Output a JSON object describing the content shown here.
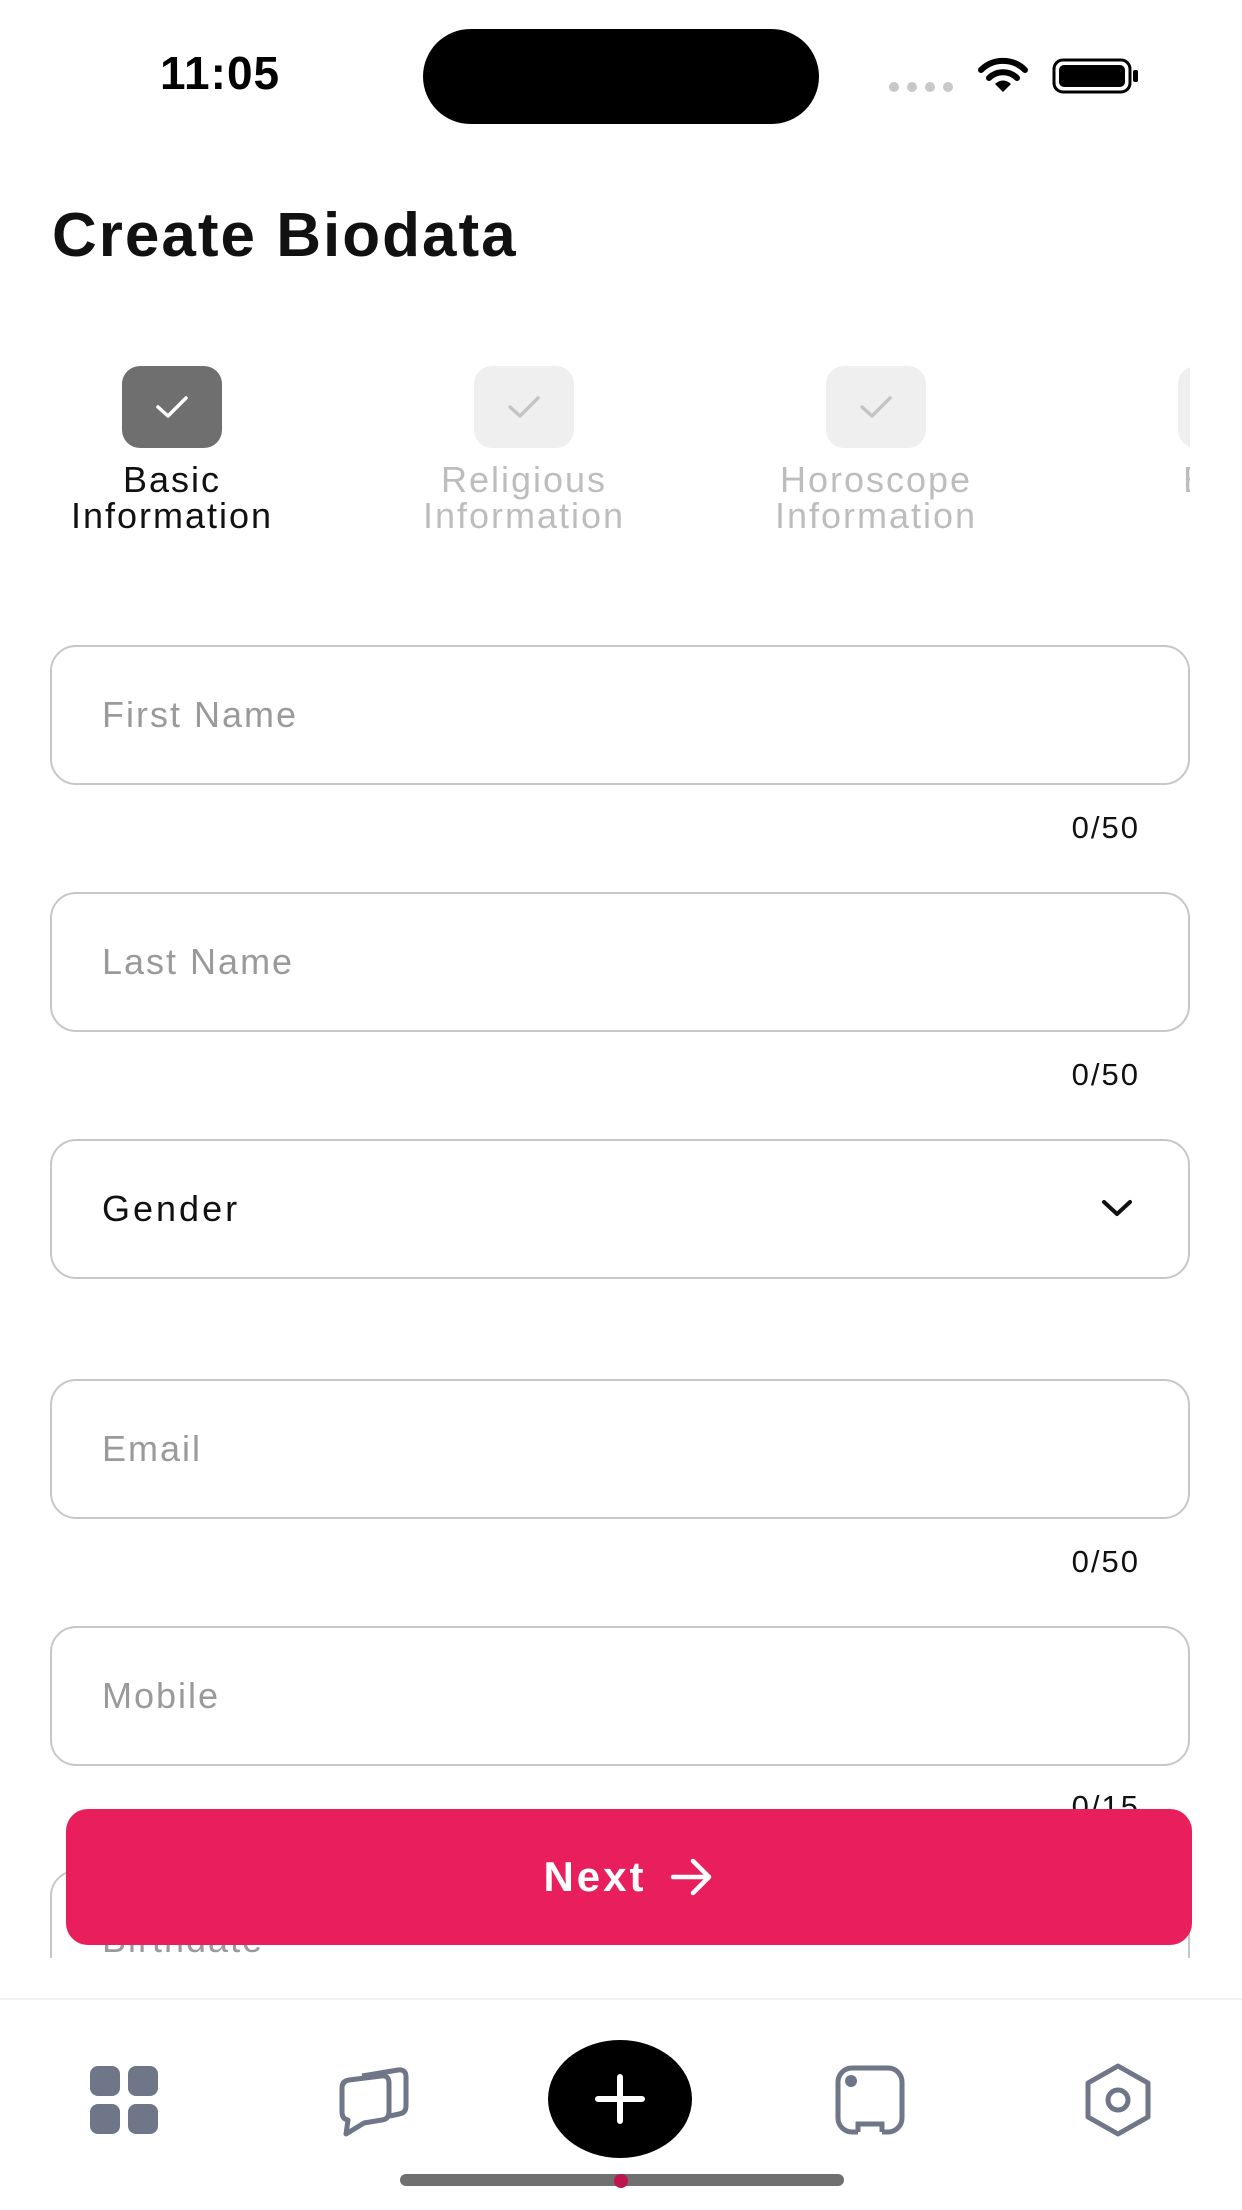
{
  "status_bar": {
    "time": "11:05"
  },
  "header": {
    "title": "Create Biodata"
  },
  "stepper": {
    "steps": [
      {
        "label": "Basic\nInformation",
        "state": "active"
      },
      {
        "label": "Religious\nInformation",
        "state": "inactive"
      },
      {
        "label": "Horoscope\nInformation",
        "state": "inactive"
      },
      {
        "label": "Educ\nLo",
        "state": "inactive"
      }
    ]
  },
  "form": {
    "first_name": {
      "placeholder": "First Name",
      "counter": "0/50"
    },
    "last_name": {
      "placeholder": "Last Name",
      "counter": "0/50"
    },
    "gender": {
      "value": "Gender"
    },
    "email": {
      "placeholder": "Email",
      "counter": "0/50"
    },
    "mobile": {
      "placeholder": "Mobile",
      "counter": "0/15"
    },
    "birthdate": {
      "placeholder": "Birthdate"
    }
  },
  "actions": {
    "next_label": "Next"
  },
  "bottom_nav": {
    "items": [
      {
        "icon": "grid-icon"
      },
      {
        "icon": "chat-icon"
      },
      {
        "icon": "plus-icon"
      },
      {
        "icon": "device-icon"
      },
      {
        "icon": "settings-icon"
      }
    ]
  },
  "colors": {
    "accent": "#e91e5c",
    "step_active": "#6f6f6f",
    "step_inactive": "#efefef",
    "border": "#c7c7c7"
  }
}
